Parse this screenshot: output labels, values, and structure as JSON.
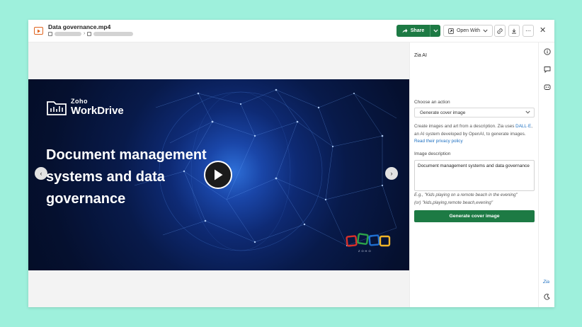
{
  "file": {
    "title": "Data governance.mp4"
  },
  "toolbar": {
    "share_label": "Share",
    "open_with_label": "Open With",
    "more_label": "⋯",
    "close_label": "✕"
  },
  "video": {
    "brand_small": "Zoho",
    "brand_large": "WorkDrive",
    "headline_line1": "Document management",
    "headline_line2": "systems and data",
    "headline_line3": "governance",
    "logo_text": "ZOHO",
    "prev_label": "‹",
    "next_label": "›"
  },
  "zia_panel": {
    "title": "Zia AI",
    "action_label": "Choose an action",
    "action_selected": "Generate cover image",
    "desc_part1": "Create images and art from a description. Zia uses ",
    "desc_link1": "DALL·E",
    "desc_part2": ", an AI system developed by OpenAI, to generate images. ",
    "desc_link2": "Read their privacy policy",
    "image_desc_label": "Image description",
    "image_desc_value": "Document management systems and data governance",
    "example_line1": "E.g., \"Kids playing on a remote beach in the evening\"",
    "example_line2": "(or) \"kids,playing,remote beach,evening\"",
    "generate_label": "Generate cover image"
  },
  "rail": {
    "zia_label": "Zia"
  },
  "colors": {
    "accent_green": "#1d7a44",
    "link_blue": "#1c6fc1",
    "file_icon_orange": "#e0641f",
    "page_background": "#9ef0dc"
  }
}
